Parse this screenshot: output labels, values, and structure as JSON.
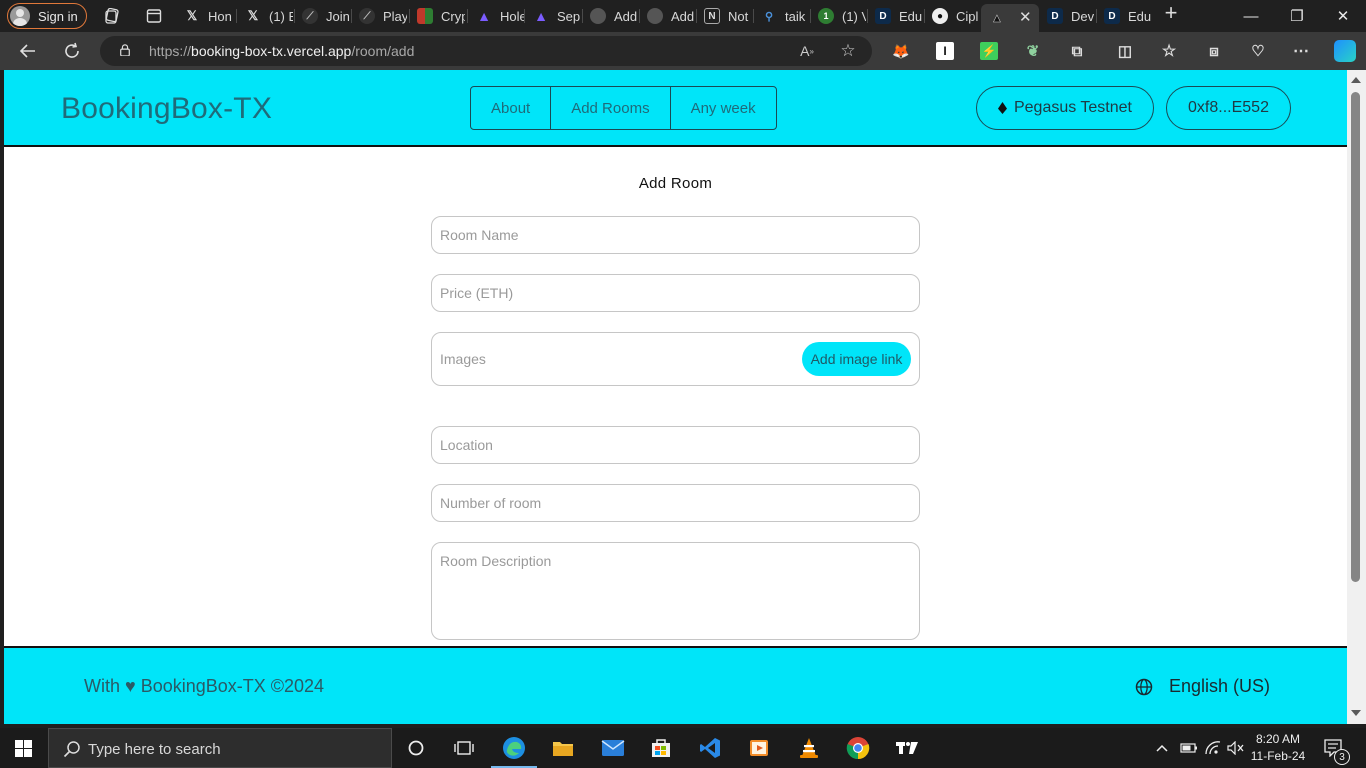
{
  "browser": {
    "signin_label": "Sign in",
    "tabs": [
      {
        "label": "Hon",
        "icon": "x-icon"
      },
      {
        "label": "(1) E",
        "icon": "x-icon"
      },
      {
        "label": "Join",
        "icon": "gauge-icon"
      },
      {
        "label": "Play",
        "icon": "gauge-icon"
      },
      {
        "label": "Cryp",
        "icon": "grid-icon"
      },
      {
        "label": "Hole",
        "icon": "triangle-icon"
      },
      {
        "label": "Sep",
        "icon": "triangle-icon"
      },
      {
        "label": "Add",
        "icon": "globe-icon"
      },
      {
        "label": "Add",
        "icon": "globe-icon"
      },
      {
        "label": "Not",
        "icon": "notion-icon"
      },
      {
        "label": "taik",
        "icon": "search-icon"
      },
      {
        "label": "(1) V",
        "icon": "circle-icon"
      },
      {
        "label": "Edu",
        "icon": "d-icon"
      },
      {
        "label": "Cipl",
        "icon": "github-icon"
      },
      {
        "label": "",
        "icon": "triangle-icon"
      },
      {
        "label": "Dev",
        "icon": "d-icon"
      },
      {
        "label": "Edu",
        "icon": "d-icon"
      }
    ],
    "url_scheme": "https://",
    "url_host": "booking-box-tx.vercel.app",
    "url_path": "/room/add"
  },
  "site": {
    "brand": "BookingBox-TX",
    "nav": [
      "About",
      "Add Rooms",
      "Any week"
    ],
    "network_label": "Pegasus Testnet",
    "wallet_label": "0xf8...E552",
    "accent": "#00e5f9"
  },
  "form": {
    "title": "Add Room",
    "room_name_placeholder": "Room Name",
    "price_placeholder": "Price (ETH)",
    "images_placeholder": "Images",
    "add_image_label": "Add image link",
    "location_placeholder": "Location",
    "number_placeholder": "Number of room",
    "description_placeholder": "Room Description"
  },
  "footer": {
    "copyright": "With ♥ BookingBox-TX ©2024",
    "language": "English (US)"
  },
  "taskbar": {
    "search_placeholder": "Type here to search",
    "time": "8:20 AM",
    "date": "11-Feb-24",
    "notification_count": "3"
  }
}
